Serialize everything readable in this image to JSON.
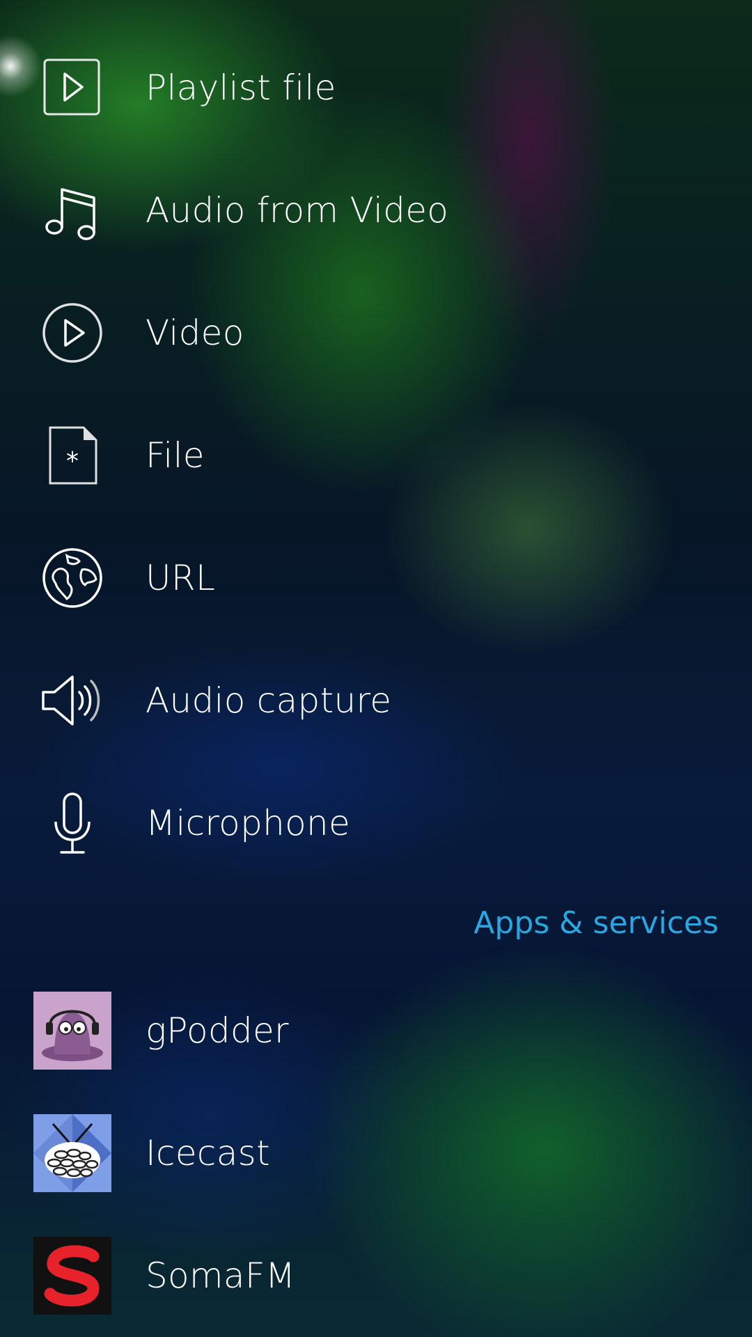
{
  "source_items": [
    {
      "label": "Playlist file",
      "icon": "playlist-file-icon"
    },
    {
      "label": "Audio from Video",
      "icon": "music-note-icon"
    },
    {
      "label": "Video",
      "icon": "video-play-icon"
    },
    {
      "label": "File",
      "icon": "file-icon"
    },
    {
      "label": "URL",
      "icon": "globe-icon"
    },
    {
      "label": "Audio capture",
      "icon": "speaker-icon"
    },
    {
      "label": "Microphone",
      "icon": "microphone-icon"
    }
  ],
  "apps_section": {
    "header": "Apps & services",
    "items": [
      {
        "label": "gPodder",
        "icon": "gpodder-icon"
      },
      {
        "label": "Icecast",
        "icon": "icecast-icon"
      },
      {
        "label": "SomaFM",
        "icon": "somafm-icon"
      }
    ]
  },
  "colors": {
    "accent": "#2aa7e0",
    "text": "#ffffff"
  }
}
